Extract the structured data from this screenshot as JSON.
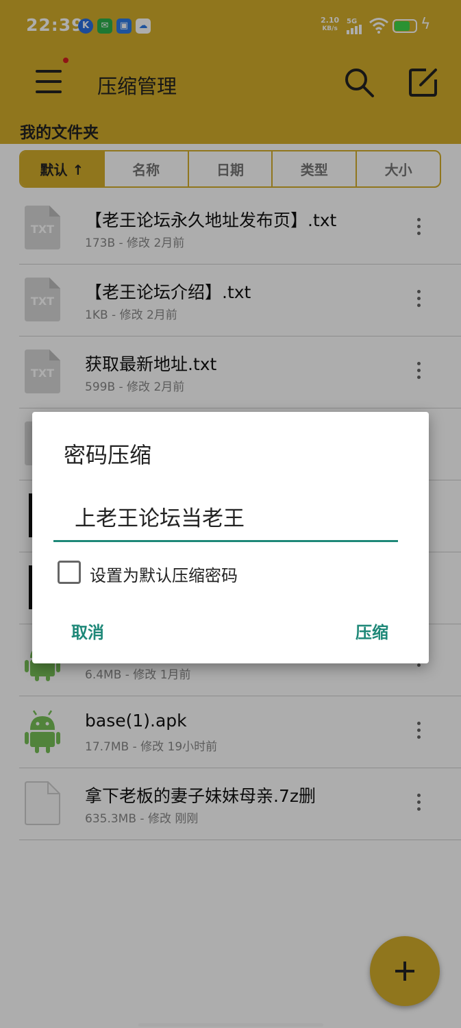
{
  "status_bar": {
    "time": "22:39",
    "net_speed_value": "2.10",
    "net_speed_unit": "KB/s",
    "network": "5G",
    "app_icons": [
      "k-app-icon",
      "wechat-icon",
      "wallet-icon",
      "baidu-netdisk-icon"
    ]
  },
  "app_bar": {
    "title": "压缩管理",
    "folder_label": "我的文件夹"
  },
  "sort_tabs": [
    {
      "label": "默认 ↑",
      "active": true
    },
    {
      "label": "名称",
      "active": false
    },
    {
      "label": "日期",
      "active": false
    },
    {
      "label": "类型",
      "active": false
    },
    {
      "label": "大小",
      "active": false
    }
  ],
  "files": [
    {
      "name": "【老王论坛永久地址发布页】.txt",
      "meta": "173B - 修改 2月前",
      "icon": "txt-file-icon"
    },
    {
      "name": "【老王论坛介绍】.txt",
      "meta": "1KB - 修改 2月前",
      "icon": "txt-file-icon"
    },
    {
      "name": "获取最新地址.txt",
      "meta": "599B - 修改 2月前",
      "icon": "txt-file-icon"
    },
    {
      "name": "",
      "meta": "",
      "icon": "txt-file-icon"
    },
    {
      "name": "",
      "meta": "",
      "icon": "image-file-icon"
    },
    {
      "name": "",
      "meta": "",
      "icon": "image-file-icon"
    },
    {
      "name": "",
      "meta": "6.4MB - 修改 1月前",
      "icon": "android-apk-icon"
    },
    {
      "name": "base(1).apk",
      "meta": "17.7MB - 修改 19小时前",
      "icon": "android-apk-icon"
    },
    {
      "name": "拿下老板的妻子妹妹母亲.7z删",
      "meta": "635.3MB - 修改 刚刚",
      "icon": "generic-file-icon"
    }
  ],
  "dialog": {
    "title": "密码压缩",
    "password_value": "上老王论坛当老王",
    "checkbox_label": "设置为默认压缩密码",
    "checkbox_checked": false,
    "cancel_label": "取消",
    "confirm_label": "压缩"
  },
  "colors": {
    "accent": "#d4ae2c",
    "dialog_button": "#1e8878",
    "android_green": "#78c257"
  }
}
